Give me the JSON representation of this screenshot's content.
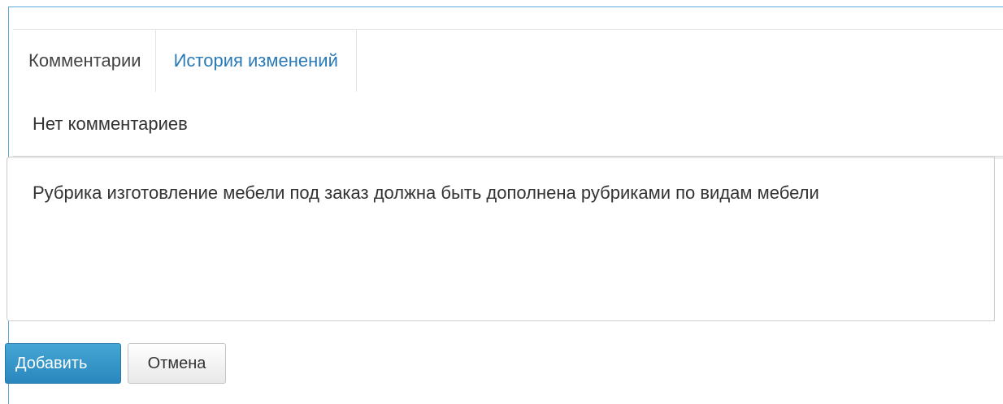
{
  "tabs": [
    {
      "label": "Комментарии",
      "active": true
    },
    {
      "label": "История изменений",
      "active": false
    }
  ],
  "comments": {
    "empty_text": "Нет комментариев"
  },
  "editor": {
    "value": "Рубрика изготовление мебели под заказ должна быть дополнена рубриками по видам мебели"
  },
  "actions": {
    "add_label": "Добавить",
    "cancel_label": "Отмена"
  },
  "colors": {
    "link": "#2a7ab7",
    "primary_button": "#2a87bd",
    "frame_border": "#5aa9d6"
  }
}
